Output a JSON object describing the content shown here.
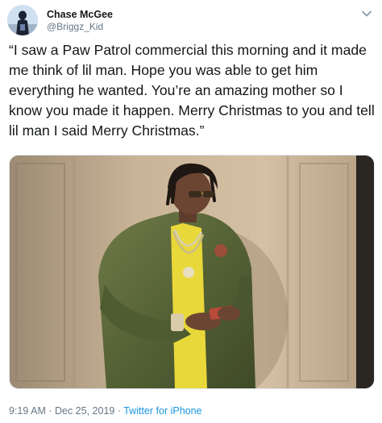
{
  "tweet": {
    "author": {
      "display_name": "Chase McGee",
      "handle": "@Briggz_Kid",
      "avatar_icon": "avatar-silhouette"
    },
    "text": "“I saw a Paw Patrol commercial this morning and it made me think of lil man. Hope you was able to get him everything he wanted. You’re an amazing mother so I know you made it happen. Merry Christmas to you and tell lil man I said Merry Christmas.”",
    "meta": {
      "time": "9:19 AM",
      "separator_1": " · ",
      "date": "Dec 25, 2019",
      "separator_2": " · ",
      "source": "Twitter for iPhone"
    },
    "menu_icon": "chevron-down-icon"
  },
  "colors": {
    "text": "#14171a",
    "secondary": "#657786",
    "link": "#1b95e0",
    "border": "#e1e8ed"
  }
}
